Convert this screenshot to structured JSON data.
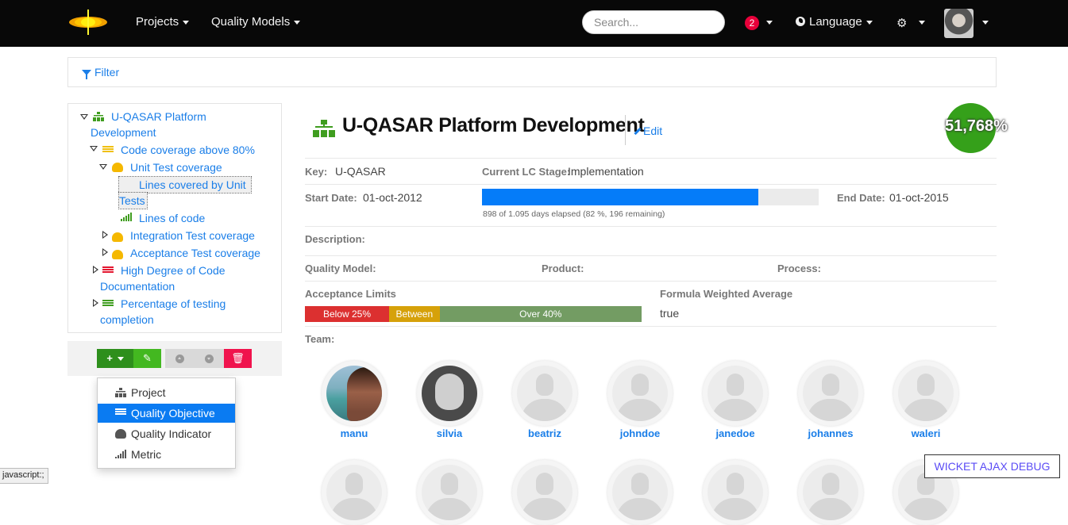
{
  "navbar": {
    "menu": [
      {
        "label": "Projects"
      },
      {
        "label": "Quality Models"
      }
    ],
    "search_placeholder": "Search...",
    "notification_count": "2",
    "language_label": "Language"
  },
  "filter": {
    "label": "Filter"
  },
  "tree": {
    "nodes": [
      {
        "label_line1": "U-QASAR Platform",
        "label_line2": "Development",
        "type": "project",
        "expanded": true
      },
      {
        "label": "Code coverage above 80%",
        "type": "quality-objective",
        "expanded": true
      },
      {
        "label": "Unit Test coverage",
        "type": "quality-indicator",
        "expanded": true
      },
      {
        "label_line1": "Lines covered by Unit",
        "label_line2": "Tests",
        "type": "metric",
        "selected": true
      },
      {
        "label": "Lines of code",
        "type": "metric"
      },
      {
        "label": "Integration Test coverage",
        "type": "quality-indicator",
        "expanded": false
      },
      {
        "label": "Acceptance Test coverage",
        "type": "quality-indicator",
        "expanded": false
      },
      {
        "label_line1": "High Degree of Code",
        "label_line2": "Documentation",
        "type": "quality-objective",
        "expanded": false
      },
      {
        "label_line1": "Percentage of testing",
        "label_line2": "completion",
        "type": "quality-objective",
        "expanded": false
      }
    ]
  },
  "add_menu": {
    "items": [
      {
        "label": "Project",
        "icon": "project-icon"
      },
      {
        "label": "Quality Objective",
        "icon": "quality-objective-icon",
        "active": true
      },
      {
        "label": "Quality Indicator",
        "icon": "quality-indicator-icon"
      },
      {
        "label": "Metric",
        "icon": "metric-icon"
      }
    ]
  },
  "status_bar": "javascript:;",
  "project": {
    "title": "U-QASAR Platform Development",
    "edit_label": "Edit",
    "score": "51,768%",
    "key_label": "Key:",
    "key": "U-QASAR",
    "lc_stage_label": "Current LC Stage:",
    "lc_stage": "Implementation",
    "start_label": "Start Date:",
    "start_date": "01-oct-2012",
    "end_label": "End Date:",
    "end_date": "01-oct-2015",
    "progress_fraction": 0.82,
    "progress_text": "898 of 1.095 days elapsed (82 %, 196 remaining)",
    "description_label": "Description:",
    "quality_model_label": "Quality Model:",
    "product_label": "Product:",
    "process_label": "Process:",
    "acceptance_label": "Acceptance Limits",
    "limits": [
      {
        "label": "Below 25%",
        "fraction": 0.25,
        "color": "#dc3030"
      },
      {
        "label": "Between",
        "fraction": 0.15,
        "color": "#d6a10a"
      },
      {
        "label": "Over 40%",
        "fraction": 0.6,
        "color": "#739c63"
      }
    ],
    "formula_label": "Formula Weighted Average",
    "formula_value": "true",
    "team_label": "Team:",
    "team": [
      {
        "name": "manu",
        "photo": "manu"
      },
      {
        "name": "silvia",
        "photo": "silvia"
      },
      {
        "name": "beatriz",
        "photo": "placeholder"
      },
      {
        "name": "johndoe",
        "photo": "placeholder"
      },
      {
        "name": "janedoe",
        "photo": "placeholder"
      },
      {
        "name": "johannes",
        "photo": "placeholder"
      },
      {
        "name": "waleri",
        "photo": "placeholder"
      }
    ]
  },
  "debug_button": "WICKET AJAX DEBUG",
  "colors": {
    "accent": "#1a7ee8",
    "navbar": "#080808",
    "score_bg": "#35a01a",
    "progress": "#057cf9",
    "danger": "#f0134d"
  }
}
